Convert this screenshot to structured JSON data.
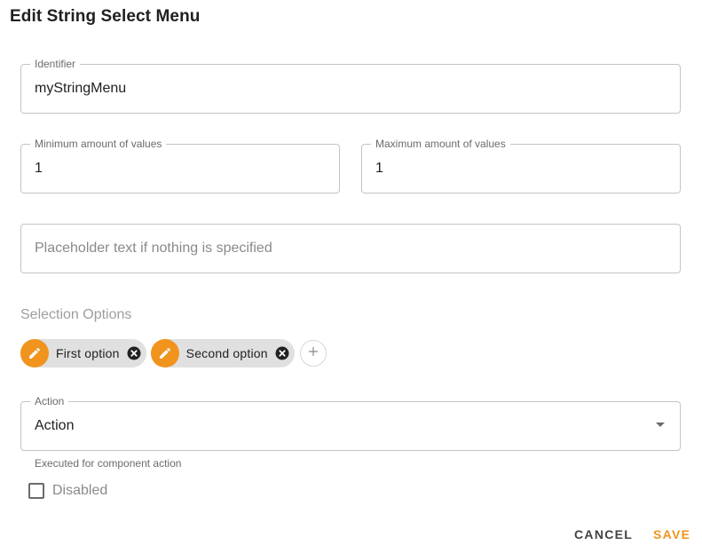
{
  "dialog": {
    "title": "Edit String Select Menu"
  },
  "identifier": {
    "label": "Identifier",
    "value": "myStringMenu"
  },
  "min_values": {
    "label": "Minimum amount of values",
    "value": "1"
  },
  "max_values": {
    "label": "Maximum amount of values",
    "value": "1"
  },
  "placeholder": {
    "value": "",
    "placeholder": "Placeholder text if nothing is specified"
  },
  "options": {
    "section_label": "Selection Options",
    "items": [
      {
        "label": "First option",
        "icon": "pencil-icon"
      },
      {
        "label": "Second option",
        "icon": "pencil-icon"
      }
    ],
    "add_icon": "plus-icon"
  },
  "action": {
    "label": "Action",
    "value": "Action",
    "helper_text": "Executed for component action"
  },
  "disabled": {
    "label": "Disabled",
    "checked": false
  },
  "buttons": {
    "cancel": "CANCEL",
    "save": "SAVE"
  },
  "colors": {
    "accent": "#f0941d",
    "border": "#c4c4c4",
    "chip_bg": "#e0e0e0"
  }
}
